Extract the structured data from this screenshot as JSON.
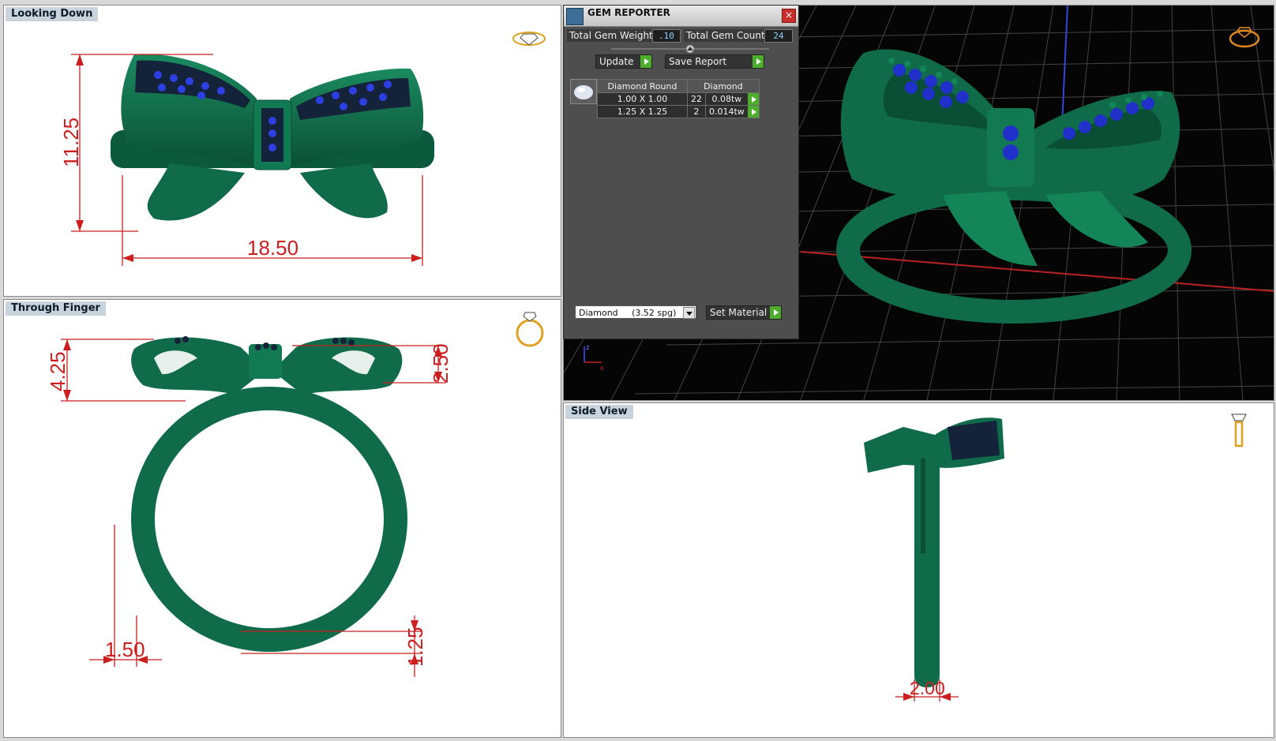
{
  "viewports": {
    "top_left": {
      "title": "Looking Down",
      "dimensions": {
        "height": "11.25",
        "width": "18.50"
      }
    },
    "bottom_left": {
      "title": "Through Finger",
      "dimensions": {
        "top_height": "4.25",
        "gallery_height": "2.50",
        "shank_width": "1.50",
        "base_thickness": "1.25"
      }
    },
    "top_right": {
      "axis_labels": {
        "z": "z",
        "x": "x"
      }
    },
    "bottom_right": {
      "title": "Side View",
      "dimensions": {
        "shank_depth": "2.00"
      }
    }
  },
  "gem_reporter": {
    "title": "GEM REPORTER",
    "close_label": "×",
    "total_weight_label": "Total Gem Weight",
    "total_weight_value": ".10",
    "total_count_label": "Total Gem Count",
    "total_count_value": "24",
    "update_label": "Update",
    "save_report_label": "Save Report",
    "table": {
      "headers": [
        "Diamond Round",
        "Diamond"
      ],
      "rows": [
        {
          "size": "1.00 X 1.00",
          "count": "22",
          "weight": "0.08tw"
        },
        {
          "size": "1.25 X 1.25",
          "count": "2",
          "weight": "0.014tw"
        }
      ]
    },
    "material_select": "Diamond     (3.52 spg)",
    "set_material_label": "Set Material"
  },
  "colors": {
    "ring_green": "#0f6b4a",
    "dimension_red": "#cc1e1e",
    "gem_blue": "#2030c8",
    "viewport_bg_dark": "#050505"
  },
  "icons": {
    "top_left": "ring-top-indicator-icon",
    "bottom_left": "ring-front-indicator-icon",
    "top_right": "ring-perspective-indicator-icon",
    "bottom_right": "ring-side-indicator-icon"
  }
}
